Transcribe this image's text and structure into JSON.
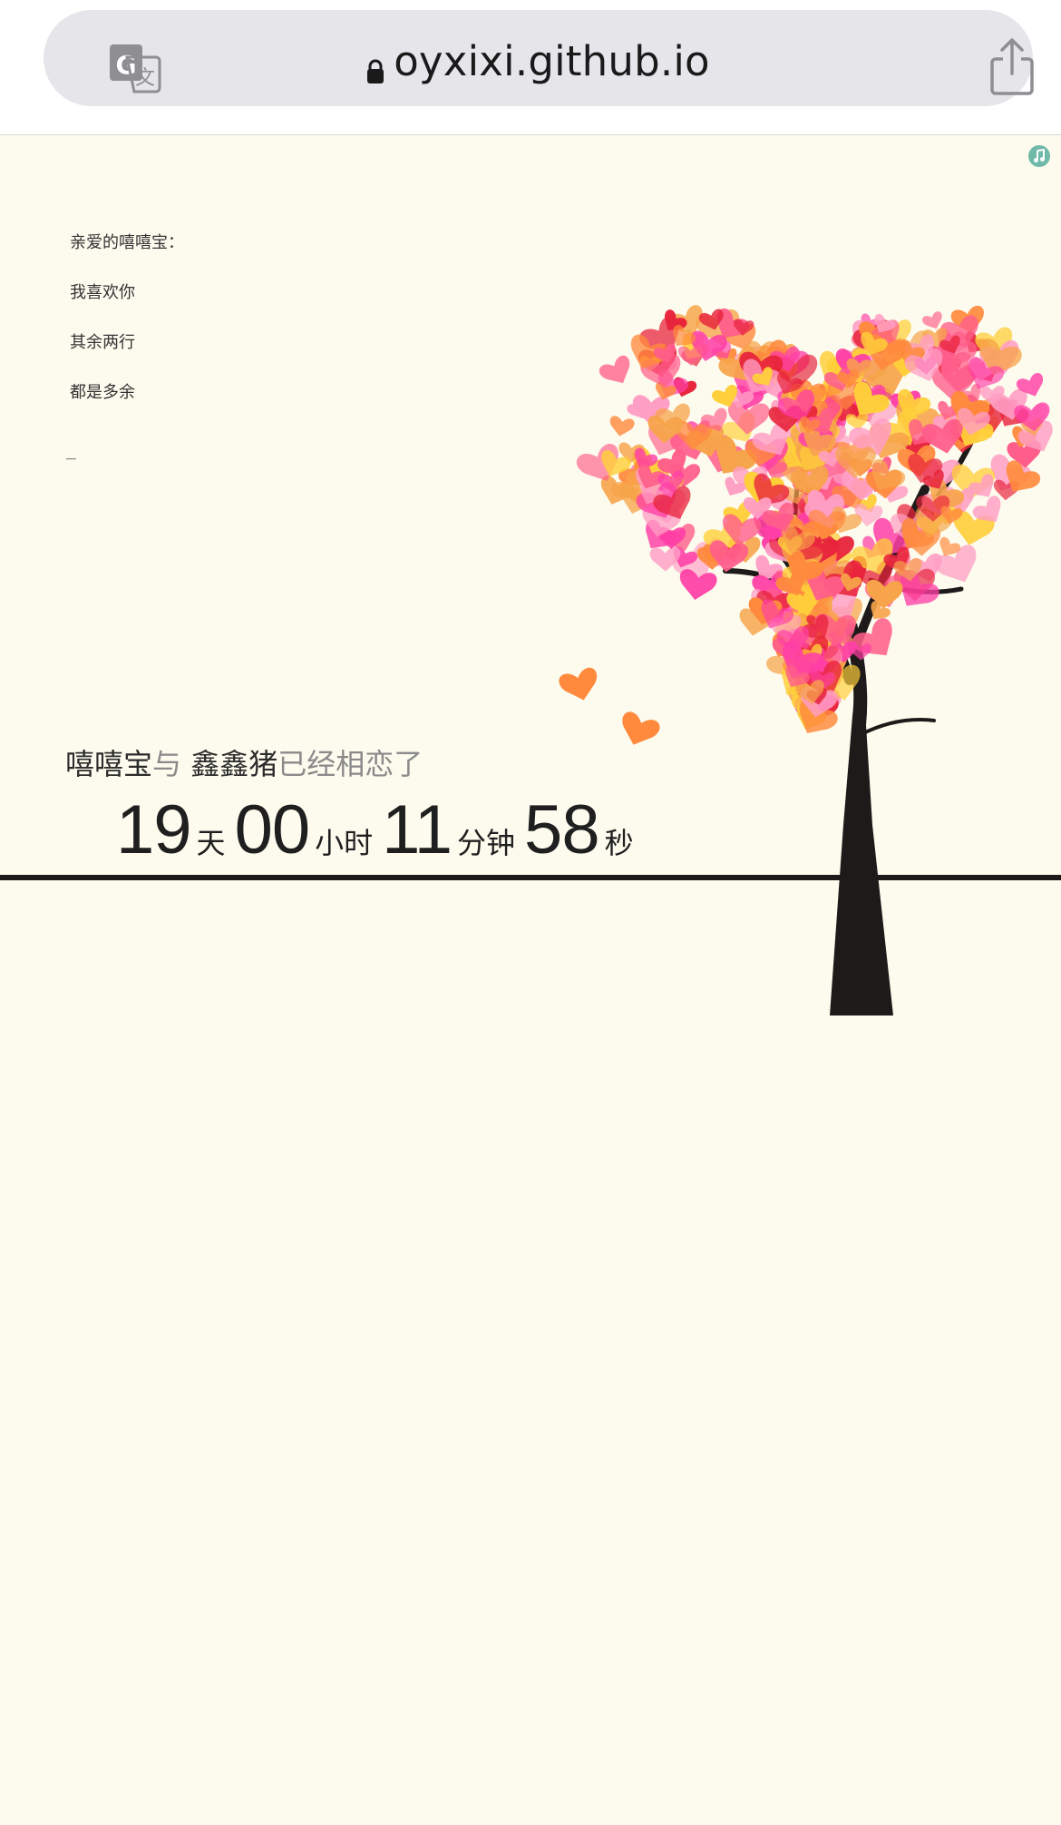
{
  "browser": {
    "url": "oyxixi.github.io",
    "translate_icon": "translate-icon",
    "lock_icon": "lock-icon",
    "share_icon": "share-icon"
  },
  "page": {
    "music_icon": "music-note-icon",
    "letter": {
      "lines": [
        "亲爱的嘻嘻宝：",
        "我喜欢你",
        "其余两行",
        "都是多余"
      ],
      "cursor": "_"
    },
    "together": {
      "name1": "嘻嘻宝",
      "connector": "与 ",
      "name2": "鑫鑫猪",
      "suffix": "已经相恋了"
    },
    "counter": {
      "days": "19",
      "days_unit": "天",
      "hours": "00",
      "hours_unit": "小时",
      "minutes": "11",
      "minutes_unit": "分钟",
      "seconds": "58",
      "seconds_unit": "秒"
    }
  },
  "colors": {
    "background": "#fcfbee",
    "trunk": "#1f1a1a",
    "heart_palette": [
      "#ff5e8a",
      "#ff8a3d",
      "#ffcf3a",
      "#ff3fa6",
      "#e8243c",
      "#ff9ec4",
      "#f7a44a"
    ]
  }
}
